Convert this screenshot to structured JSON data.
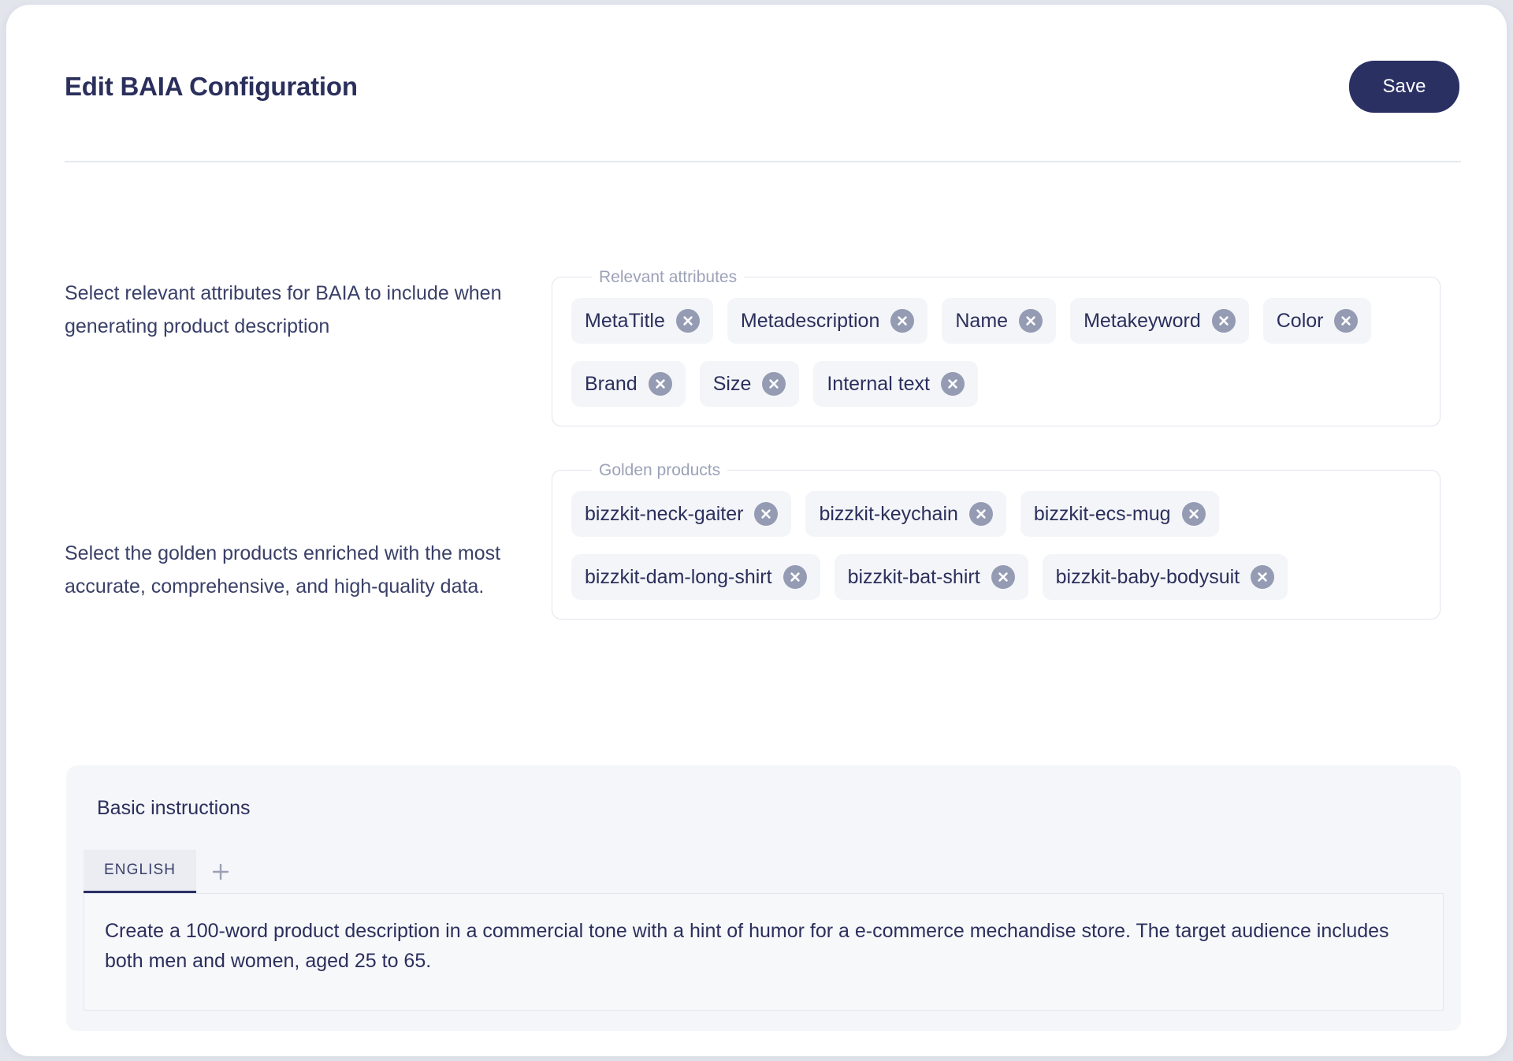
{
  "header": {
    "title": "Edit BAIA Configuration",
    "save_label": "Save"
  },
  "sections": [
    {
      "label": "Select relevant attributes for BAIA to include when generating product description",
      "legend": "Relevant attributes",
      "chips": [
        "MetaTitle",
        "Metadescription",
        "Name",
        "Metakeyword",
        "Color",
        "Brand",
        "Size",
        "Internal text"
      ]
    },
    {
      "label": "Select the golden products enriched with the most accurate, comprehensive, and high-quality data.",
      "legend": "Golden products",
      "chips": [
        "bizzkit-neck-gaiter",
        "bizzkit-keychain",
        "bizzkit-ecs-mug",
        "bizzkit-dam-long-shirt",
        "bizzkit-bat-shirt",
        "bizzkit-baby-bodysuit"
      ]
    }
  ],
  "instructions": {
    "title": "Basic instructions",
    "tabs": [
      {
        "label": "ENGLISH",
        "active": true
      }
    ],
    "add_tab_icon": "plus-icon",
    "value": "Create a 100-word product description in a commercial tone with a hint of humor for a e-commerce mechandise store. The target audience includes both men and women, aged 25 to 65."
  },
  "colors": {
    "accent": "#2b3063",
    "text": "#2b2f5c",
    "muted": "#9ca2b8",
    "chip_bg": "#f4f5f8",
    "chip_remove": "#949bb3",
    "page_bg": "#e2e5ec",
    "card_bg": "#ffffff"
  }
}
